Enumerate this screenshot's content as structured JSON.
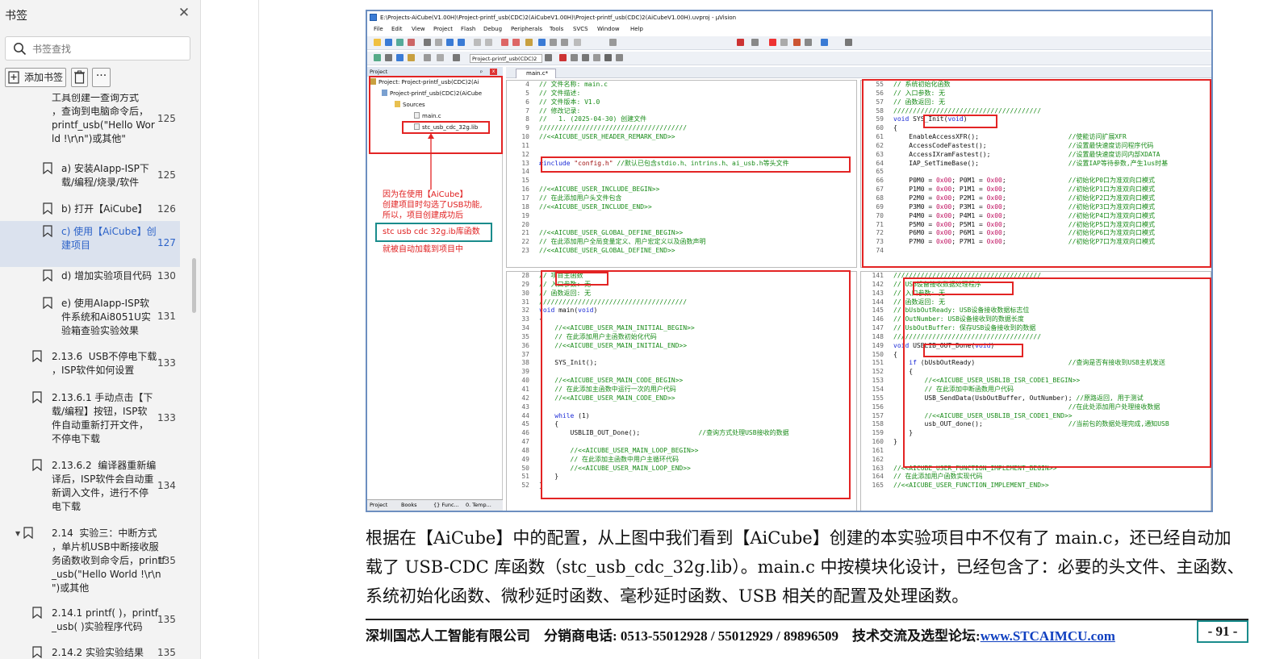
{
  "sidebar": {
    "title": "书签",
    "search_placeholder": "书签查找",
    "add_label": "添加书签",
    "more_label": "···",
    "items": [
      {
        "text": "工具创建一查询方式\n，查询到电脑命令后，\nprintf_usb(\"Hello Wor\nld !\\r\\n\")或其他\"",
        "page": "125"
      },
      {
        "text": "a) 安装AIapp-ISP下\n载/编程/烧录/软件",
        "page": "125"
      },
      {
        "text": "b) 打开【AiCube】",
        "page": "126"
      },
      {
        "text": "c) 使用【AiCube】创\n建项目",
        "page": "127"
      },
      {
        "text": "d) 增加实验项目代码",
        "page": "130"
      },
      {
        "text": "e) 使用AIapp-ISP软\n件系统和Ai8051U实\n验箱查验实验效果",
        "page": "131"
      },
      {
        "text": "2.13.6  USB不停电下载\n，ISP软件如何设置",
        "page": "133"
      },
      {
        "text": "2.13.6.1 手动点击【下\n载/编程】按钮，ISP软\n件自动重新打开文件，\n不停电下载",
        "page": "133"
      },
      {
        "text": "2.13.6.2  编译器重新编\n译后，ISP软件会自动重\n新调入文件，进行不停\n电下载",
        "page": "134"
      },
      {
        "text": "2.14  实验三：中断方式\n，单片机USB中断接收服\n务函数收到命令后，printf\n_usb(\"Hello World !\\r\\n\n\")或其他",
        "page": "135"
      },
      {
        "text": "2.14.1 printf( )，printf\n_usb( )实验程序代码",
        "page": "135"
      },
      {
        "text": "2.14.2 实验实验结果",
        "page": "135"
      }
    ]
  },
  "uvision": {
    "title": "E:\\Projects-AiCube(V1.00H)\\Project-printf_usb(CDC)2(AiCubeV1.00H)\\Project-printf_usb(CDC)2(AiCubeV1.00H).uvproj - µVision",
    "menu": [
      "File",
      "Edit",
      "View",
      "Project",
      "Flash",
      "Debug",
      "Peripherals",
      "Tools",
      "SVCS",
      "Window",
      "Help"
    ],
    "target": "Project-printf_usb(CDC)2",
    "project_panel_title": "Project",
    "tree": [
      "Project: Project-printf_usb(CDC)2(Ai",
      "Project-printf_usb(CDC)2(AiCube",
      "Sources",
      "main.c",
      "stc_usb_cdc_32g.lib"
    ],
    "note": "因为在使用【AiCube】\n创建项目时勾选了USB功能,\n所以，项目创建成功后",
    "note_lib": "stc usb cdc 32g.ib库函数",
    "note_after": "就被自动加载到项目中",
    "panel_tabs": [
      "Project",
      "Books",
      "{} Func...",
      "0. Temp..."
    ],
    "editor_tab": "main.c*"
  },
  "code_panes": {
    "tl": [
      [
        "4",
        "// 文件名称: main.c"
      ],
      [
        "5",
        "// 文件描述:"
      ],
      [
        "6",
        "// 文件版本: V1.0"
      ],
      [
        "7",
        "// 修改记录:"
      ],
      [
        "8",
        "//   1. (2025-04-30) 创建文件"
      ],
      [
        "9",
        "//////////////////////////////////////"
      ],
      [
        "10",
        "//<<AICUBE_USER_HEADER_REMARK_END>>"
      ],
      [
        "11",
        ""
      ],
      [
        "12",
        ""
      ],
      [
        "13",
        "#include \"config.h\" //默认已包含stdio.h、intrins.h、ai_usb.h等头文件"
      ],
      [
        "14",
        ""
      ],
      [
        "15",
        ""
      ],
      [
        "16",
        "//<<AICUBE_USER_INCLUDE_BEGIN>>"
      ],
      [
        "17",
        "// 在此添加用户头文件包含"
      ],
      [
        "18",
        "//<<AICUBE_USER_INCLUDE_END>>"
      ],
      [
        "19",
        ""
      ],
      [
        "20",
        ""
      ],
      [
        "21",
        "//<<AICUBE_USER_GLOBAL_DEFINE_BEGIN>>"
      ],
      [
        "22",
        "// 在此添加用户全局变量定义、用户宏定义以及函数声明"
      ],
      [
        "23",
        "//<<AICUBE_USER_GLOBAL_DEFINE_END>>"
      ]
    ],
    "tr": [
      [
        "55",
        "// 系统初始化函数"
      ],
      [
        "56",
        "// 入口参数: 无"
      ],
      [
        "57",
        "// 函数返回: 无"
      ],
      [
        "58",
        "//////////////////////////////////////"
      ],
      [
        "59",
        "void SYS_Init(void)"
      ],
      [
        "60",
        "{"
      ],
      [
        "61",
        "    EnableAccessXFR();                       //使能访问扩展XFR"
      ],
      [
        "62",
        "    AccessCodeFastest();                     //设置最快速度访问程序代码"
      ],
      [
        "63",
        "    AccessIXramFastest();                    //设置最快速度访问内部XDATA"
      ],
      [
        "64",
        "    IAP_SetTimeBase();                       //设置IAP等待参数,产生1us时基"
      ],
      [
        "65",
        ""
      ],
      [
        "66",
        "    P0M0 = 0x00; P0M1 = 0x00;                //初始化P0口为准双向口模式"
      ],
      [
        "67",
        "    P1M0 = 0x00; P1M1 = 0x00;                //初始化P1口为准双向口模式"
      ],
      [
        "68",
        "    P2M0 = 0x00; P2M1 = 0x00;                //初始化P2口为准双向口模式"
      ],
      [
        "69",
        "    P3M0 = 0x00; P3M1 = 0x00;                //初始化P3口为准双向口模式"
      ],
      [
        "70",
        "    P4M0 = 0x00; P4M1 = 0x00;                //初始化P4口为准双向口模式"
      ],
      [
        "71",
        "    P5M0 = 0x00; P5M1 = 0x00;                //初始化P5口为准双向口模式"
      ],
      [
        "72",
        "    P6M0 = 0x00; P6M1 = 0x00;                //初始化P6口为准双向口模式"
      ],
      [
        "73",
        "    P7M0 = 0x00; P7M1 = 0x00;                //初始化P7口为准双向口模式"
      ],
      [
        "74",
        ""
      ]
    ],
    "bl": [
      [
        "28",
        "// 项目主函数"
      ],
      [
        "29",
        "// 入口参数: 无"
      ],
      [
        "30",
        "// 函数返回: 无"
      ],
      [
        "31",
        "//////////////////////////////////////"
      ],
      [
        "32",
        "void main(void)"
      ],
      [
        "33",
        "{"
      ],
      [
        "34",
        "    //<<AICUBE_USER_MAIN_INITIAL_BEGIN>>"
      ],
      [
        "35",
        "    // 在此添加用户主函数初始化代码"
      ],
      [
        "36",
        "    //<<AICUBE_USER_MAIN_INITIAL_END>>"
      ],
      [
        "37",
        ""
      ],
      [
        "38",
        "    SYS_Init();"
      ],
      [
        "39",
        ""
      ],
      [
        "40",
        "    //<<AICUBE_USER_MAIN_CODE_BEGIN>>"
      ],
      [
        "41",
        "    // 在此添加主函数中运行一次的用户代码"
      ],
      [
        "42",
        "    //<<AICUBE_USER_MAIN_CODE_END>>"
      ],
      [
        "43",
        ""
      ],
      [
        "44",
        "    while (1)"
      ],
      [
        "45",
        "    {"
      ],
      [
        "46",
        "        USBLIB_OUT_Done();               //查询方式处理USB接收的数据"
      ],
      [
        "47",
        ""
      ],
      [
        "48",
        "        //<<AICUBE_USER_MAIN_LOOP_BEGIN>>"
      ],
      [
        "49",
        "        // 在此添加主函数中用户主循环代码"
      ],
      [
        "50",
        "        //<<AICUBE_USER_MAIN_LOOP_END>>"
      ],
      [
        "51",
        "    }"
      ],
      [
        "52",
        "}"
      ]
    ],
    "br": [
      [
        "141",
        "//////////////////////////////////////"
      ],
      [
        "142",
        "// USB设备接收数据处理程序"
      ],
      [
        "143",
        "// 入口参数: 无"
      ],
      [
        "144",
        "// 函数返回: 无"
      ],
      [
        "145",
        "// bUsbOutReady: USB设备接收数据标志位"
      ],
      [
        "146",
        "// OutNumber: USB设备接收到的数据长度"
      ],
      [
        "147",
        "// UsbOutBuffer: 保存USB设备接收到的数据"
      ],
      [
        "148",
        "//////////////////////////////////////"
      ],
      [
        "149",
        "void USBLIB_OUT_Done(void)"
      ],
      [
        "150",
        "{"
      ],
      [
        "151",
        "    if (bUsbOutReady)                        //查询是否有接收到USB主机发送"
      ],
      [
        "152",
        "    {"
      ],
      [
        "153",
        "        //<<AICUBE_USER_USBLIB_ISR_CODE1_BEGIN>>"
      ],
      [
        "154",
        "        // 在此添加中断函数用户代码"
      ],
      [
        "155",
        "        USB_SendData(UsbOutBuffer, OutNumber); //原路返回, 用于测试"
      ],
      [
        "156",
        "                                             //在此处添加用户处理接收数据"
      ],
      [
        "157",
        "        //<<AICUBE_USER_USBLIB_ISR_CODE1_END>>"
      ],
      [
        "158",
        "        usb_OUT_done();                      //当前包的数据处理完成,通知USB"
      ],
      [
        "159",
        "    }"
      ],
      [
        "160",
        "}"
      ],
      [
        "161",
        ""
      ],
      [
        "162",
        ""
      ],
      [
        "163",
        "//<<AICUBE_USER_FUNCTION_IMPLEMENT_BEGIN>>"
      ],
      [
        "164",
        "// 在此添加用户函数实现代码"
      ],
      [
        "165",
        "//<<AICUBE_USER_FUNCTION_IMPLEMENT_END>>"
      ]
    ]
  },
  "caption": "根据在【AiCube】中的配置，从上图中我们看到【AiCube】创建的本实验项目中不仅有了 main.c，还已经自动加载了 USB-CDC 库函数（stc_usb_cdc_32g.lib）。main.c 中按模块化设计，已经包含了：必要的头文件、主函数、系统初始化函数、微秒延时函数、毫秒延时函数、USB 相关的配置及处理函数。",
  "footer": {
    "company": "深圳国芯人工智能有限公司",
    "phone": "分销商电话: 0513-55012928 / 55012929 / 89896509",
    "forum": "技术交流及选型论坛:",
    "url": "www.STCAIMCU.com",
    "page": "- 91 -"
  },
  "colors": {
    "highlight_red": "#e32424",
    "teal": "#1a8c8c",
    "selection": "#dbe2ee",
    "link": "#2b62c8"
  }
}
